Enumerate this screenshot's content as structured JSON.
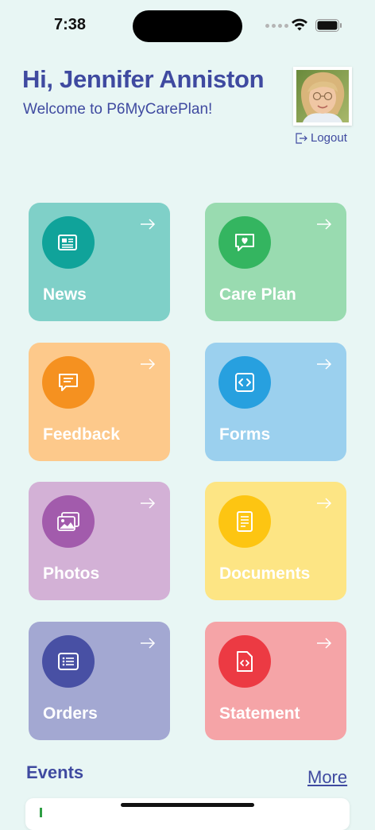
{
  "status_bar": {
    "time": "7:38"
  },
  "header": {
    "greeting": "Hi, Jennifer Anniston",
    "welcome": "Welcome to P6MyCarePlan!",
    "logout_label": "Logout"
  },
  "tiles": [
    {
      "label": "News",
      "icon": "newspaper-icon",
      "bg": "#7fd0c8",
      "circle": "#10a39a"
    },
    {
      "label": "Care Plan",
      "icon": "heart-chat-icon",
      "bg": "#99dbb0",
      "circle": "#34b560"
    },
    {
      "label": "Feedback",
      "icon": "message-icon",
      "bg": "#fdc98b",
      "circle": "#f59120"
    },
    {
      "label": "Forms",
      "icon": "code-icon",
      "bg": "#9bd0ee",
      "circle": "#27a0df"
    },
    {
      "label": "Photos",
      "icon": "image-icon",
      "bg": "#d3b1d6",
      "circle": "#a25bac"
    },
    {
      "label": "Documents",
      "icon": "document-icon",
      "bg": "#fde584",
      "circle": "#fdc512"
    },
    {
      "label": "Orders",
      "icon": "list-icon",
      "bg": "#a3a8d2",
      "circle": "#4850a4"
    },
    {
      "label": "Statement",
      "icon": "code-file-icon",
      "bg": "#f5a4a7",
      "circle": "#ec3a43"
    }
  ],
  "events": {
    "title": "Events",
    "more_label": "More"
  }
}
